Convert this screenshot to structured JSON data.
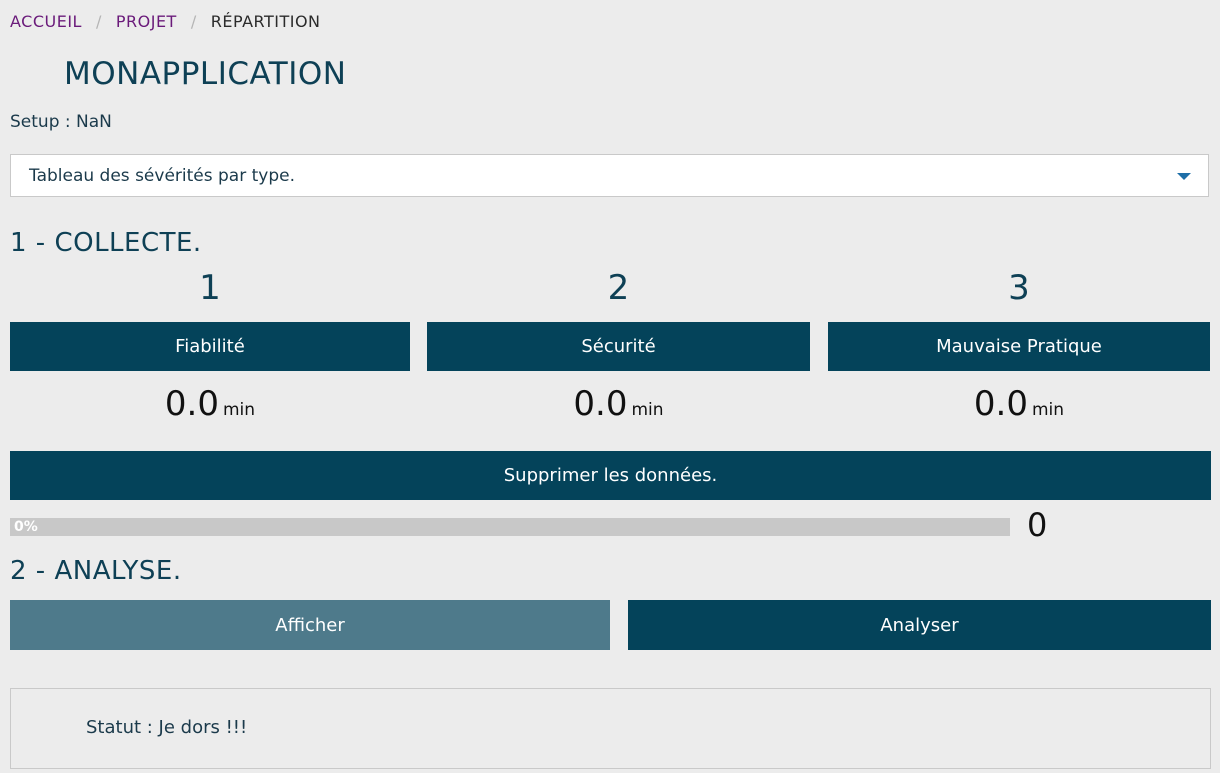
{
  "breadcrumb": {
    "items": [
      "ACCUEIL",
      "PROJET",
      "RÉPARTITION"
    ],
    "separator": "/"
  },
  "app": {
    "title": "MONAPPLICATION"
  },
  "setup": {
    "label": "Setup : NaN"
  },
  "select": {
    "value": "Tableau des sévérités par type."
  },
  "section1": {
    "title": "1 - COLLECTE."
  },
  "columns": [
    {
      "number": "1",
      "label": "Fiabilité",
      "value": "0.0",
      "unit": "min"
    },
    {
      "number": "2",
      "label": "Sécurité",
      "value": "0.0",
      "unit": "min"
    },
    {
      "number": "3",
      "label": "Mauvaise Pratique",
      "value": "0.0",
      "unit": "min"
    }
  ],
  "delete_button": {
    "label": "Supprimer les données."
  },
  "progress": {
    "percent": 0,
    "label": "0%",
    "counter": "0"
  },
  "section2": {
    "title": "2 - ANALYSE."
  },
  "actions": {
    "show": "Afficher",
    "analyze": "Analyser"
  },
  "status": {
    "text": "Statut : Je dors !!!"
  },
  "colors": {
    "primary": "#04435a",
    "secondary": "#4e7a8b",
    "link": "#6a1a7a"
  }
}
